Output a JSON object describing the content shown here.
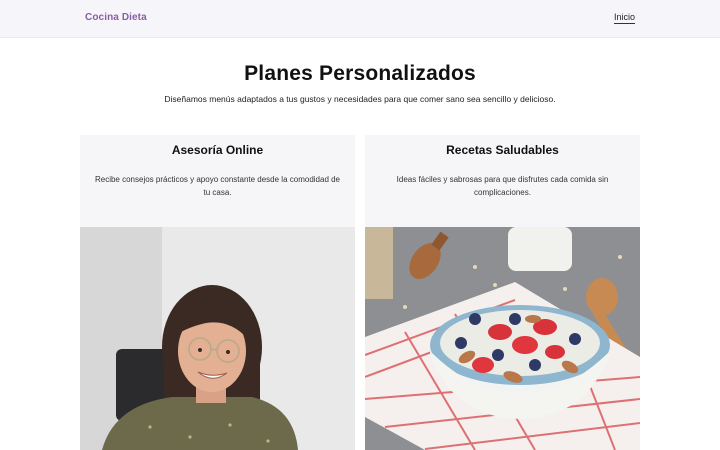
{
  "header": {
    "brand": "Cocina Dieta",
    "nav_link": "Inicio"
  },
  "hero": {
    "title": "Planes Personalizados",
    "subtitle": "Diseñamos menús adaptados a tus gustos y necesidades para que comer sano sea sencillo y delicioso."
  },
  "cards": [
    {
      "title": "Asesoría Online",
      "text": "Recibe consejos prácticos y apoyo constante desde la comodidad de tu casa.",
      "image": "portrait-photo"
    },
    {
      "title": "Recetas Saludables",
      "text": "Ideas fáciles y sabrosas para que disfrutes cada comida sin complicaciones.",
      "image": "oatmeal-bowl-photo"
    }
  ],
  "colors": {
    "brand": "#8a5da6",
    "header_bg": "#f6f5f9",
    "card_bg": "#f6f6f9"
  }
}
